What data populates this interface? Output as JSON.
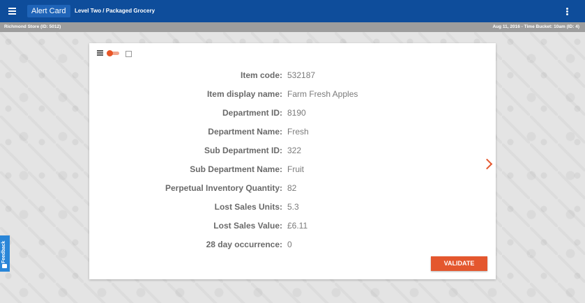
{
  "appbar": {
    "title": "Alert Card",
    "breadcrumb": "Level Two / Packaged Grocery"
  },
  "subbar": {
    "store": "Richmond Store (ID: 5012)",
    "time_bucket": "Aug 11, 2016 - Time Bucket: 10am (ID: 4)"
  },
  "card": {
    "rows": [
      {
        "label": "Item code:",
        "value": "532187"
      },
      {
        "label": "Item display name:",
        "value": "Farm Fresh Apples"
      },
      {
        "label": "Department ID:",
        "value": "8190"
      },
      {
        "label": "Department Name:",
        "value": "Fresh"
      },
      {
        "label": "Sub Department ID:",
        "value": "322"
      },
      {
        "label": "Sub Department Name:",
        "value": "Fruit"
      },
      {
        "label": "Perpetual Inventory Quantity:",
        "value": "82"
      },
      {
        "label": "Lost Sales Units:",
        "value": "5.3"
      },
      {
        "label": "Lost Sales Value:",
        "value": "£6.11"
      },
      {
        "label": "28 day occurrence:",
        "value": "0"
      }
    ],
    "validate_label": "VALIDATE",
    "toggle_on": true
  },
  "feedback": {
    "label": "Feedback"
  },
  "icons": [
    "menu-icon",
    "more-vert-icon",
    "list-icon",
    "chart-icon",
    "chevron-right-icon",
    "feedback-icon"
  ],
  "colors": {
    "appbar": "#0e4d9b",
    "subbar": "#9d9d9d",
    "accent": "#e4572e",
    "feedback": "#2a86d8"
  }
}
